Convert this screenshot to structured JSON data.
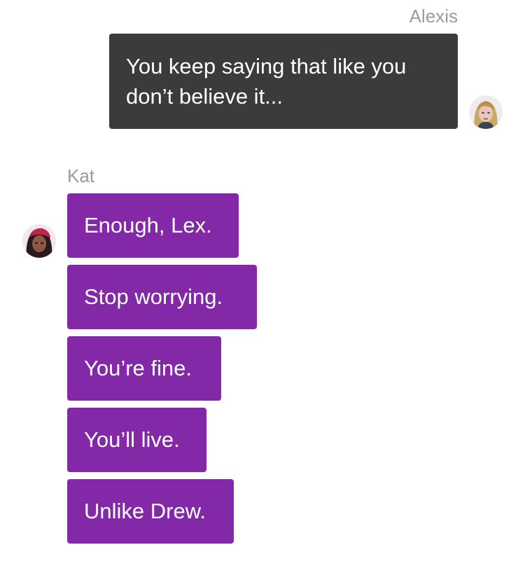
{
  "conversation": {
    "outgoing": {
      "sender": "Alexis",
      "avatar_icon": "alexis-avatar",
      "bubble_color": "#3b3b3b",
      "message": "You keep saying that like you don’t believe it..."
    },
    "incoming": {
      "sender": "Kat",
      "avatar_icon": "kat-avatar",
      "bubble_color": "#8329a8",
      "messages": [
        "Enough, Lex.",
        "Stop worrying.",
        "You’re fine.",
        "You’ll live.",
        "Unlike Drew."
      ]
    }
  }
}
